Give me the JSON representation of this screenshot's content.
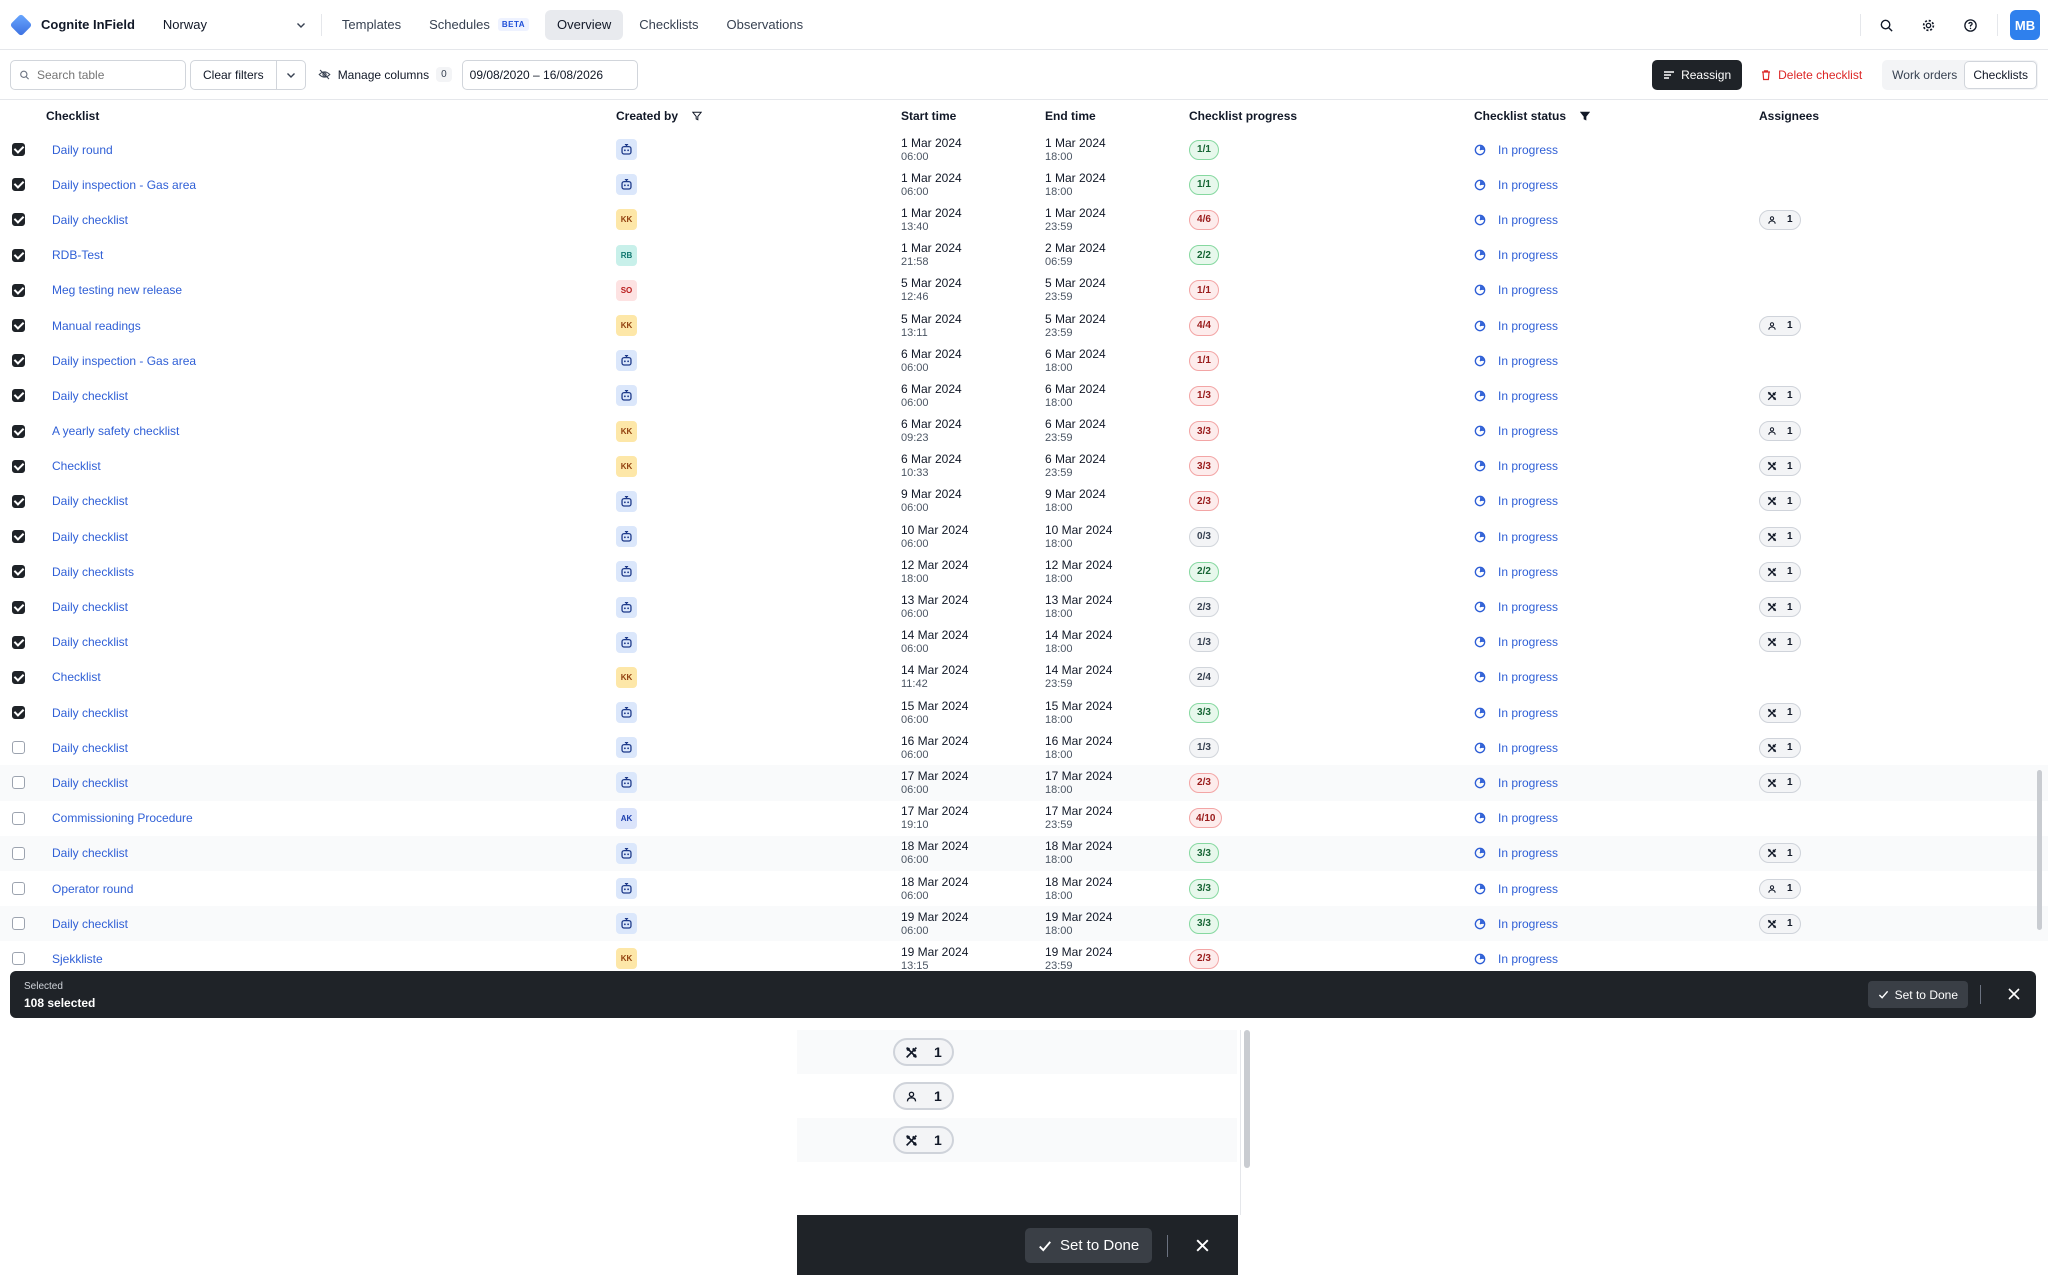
{
  "app": {
    "name": "Cognite InField",
    "site": "Norway",
    "nav_tabs": [
      {
        "label": "Templates",
        "active": false
      },
      {
        "label": "Schedules",
        "badge": "BETA",
        "active": false
      },
      {
        "label": "Overview",
        "active": true
      },
      {
        "label": "Checklists",
        "active": false
      },
      {
        "label": "Observations",
        "active": false
      }
    ],
    "user_initials": "MB",
    "accent_color": "#2f80ed",
    "icons": [
      "search-icon",
      "gear-icon",
      "help-icon"
    ]
  },
  "toolbar": {
    "search_placeholder": "Search table",
    "clear_filters": "Clear filters",
    "manage_columns": "Manage columns",
    "manage_columns_count": "0",
    "date_range": "09/08/2020 – 16/08/2026",
    "reassign": "Reassign",
    "delete_checklist": "Delete checklist",
    "view_toggle": [
      {
        "label": "Work orders",
        "active": false
      },
      {
        "label": "Checklists",
        "active": true
      }
    ]
  },
  "table": {
    "columns": [
      "Checklist",
      "Created by",
      "Start time",
      "End time",
      "Checklist progress",
      "Checklist status",
      "Assignees"
    ],
    "rows": [
      {
        "checked": true,
        "name": "Daily round",
        "creator": "bot",
        "start_date": "1 Mar 2024",
        "start_time": "06:00",
        "end_date": "1 Mar 2024",
        "end_time": "18:00",
        "progress": "1/1",
        "progress_tone": "green",
        "status": "In progress",
        "assignee": null
      },
      {
        "checked": true,
        "name": "Daily inspection - Gas area",
        "creator": "bot",
        "start_date": "1 Mar 2024",
        "start_time": "06:00",
        "end_date": "1 Mar 2024",
        "end_time": "18:00",
        "progress": "1/1",
        "progress_tone": "green",
        "status": "In progress",
        "assignee": null
      },
      {
        "checked": true,
        "name": "Daily checklist",
        "creator": "KK",
        "start_date": "1 Mar 2024",
        "start_time": "13:40",
        "end_date": "1 Mar 2024",
        "end_time": "23:59",
        "progress": "4/6",
        "progress_tone": "red",
        "status": "In progress",
        "assignee": {
          "type": "person",
          "count": "1"
        }
      },
      {
        "checked": true,
        "name": "RDB-Test",
        "creator": "RB",
        "start_date": "1 Mar 2024",
        "start_time": "21:58",
        "end_date": "2 Mar 2024",
        "end_time": "06:59",
        "progress": "2/2",
        "progress_tone": "green",
        "status": "In progress",
        "assignee": null
      },
      {
        "checked": true,
        "name": "Meg testing new release",
        "creator": "SO",
        "start_date": "5 Mar 2024",
        "start_time": "12:46",
        "end_date": "5 Mar 2024",
        "end_time": "23:59",
        "progress": "1/1",
        "progress_tone": "red",
        "status": "In progress",
        "assignee": null
      },
      {
        "checked": true,
        "name": "Manual readings",
        "creator": "KK",
        "start_date": "5 Mar 2024",
        "start_time": "13:11",
        "end_date": "5 Mar 2024",
        "end_time": "23:59",
        "progress": "4/4",
        "progress_tone": "red",
        "status": "In progress",
        "assignee": {
          "type": "person",
          "count": "1"
        }
      },
      {
        "checked": true,
        "name": "Daily inspection - Gas area",
        "creator": "bot",
        "start_date": "6 Mar 2024",
        "start_time": "06:00",
        "end_date": "6 Mar 2024",
        "end_time": "18:00",
        "progress": "1/1",
        "progress_tone": "red",
        "status": "In progress",
        "assignee": null
      },
      {
        "checked": true,
        "name": "Daily checklist",
        "creator": "bot",
        "start_date": "6 Mar 2024",
        "start_time": "06:00",
        "end_date": "6 Mar 2024",
        "end_time": "18:00",
        "progress": "1/3",
        "progress_tone": "red",
        "status": "In progress",
        "assignee": {
          "type": "group",
          "count": "1"
        }
      },
      {
        "checked": true,
        "name": "A yearly safety checklist",
        "creator": "KK",
        "start_date": "6 Mar 2024",
        "start_time": "09:23",
        "end_date": "6 Mar 2024",
        "end_time": "23:59",
        "progress": "3/3",
        "progress_tone": "red",
        "status": "In progress",
        "assignee": {
          "type": "person",
          "count": "1"
        }
      },
      {
        "checked": true,
        "name": "Checklist",
        "creator": "KK",
        "start_date": "6 Mar 2024",
        "start_time": "10:33",
        "end_date": "6 Mar 2024",
        "end_time": "23:59",
        "progress": "3/3",
        "progress_tone": "red",
        "status": "In progress",
        "assignee": {
          "type": "group",
          "count": "1"
        }
      },
      {
        "checked": true,
        "name": "Daily checklist",
        "creator": "bot",
        "start_date": "9 Mar 2024",
        "start_time": "06:00",
        "end_date": "9 Mar 2024",
        "end_time": "18:00",
        "progress": "2/3",
        "progress_tone": "red",
        "status": "In progress",
        "assignee": {
          "type": "group",
          "count": "1"
        }
      },
      {
        "checked": true,
        "name": "Daily checklist",
        "creator": "bot",
        "start_date": "10 Mar 2024",
        "start_time": "06:00",
        "end_date": "10 Mar 2024",
        "end_time": "18:00",
        "progress": "0/3",
        "progress_tone": "grey",
        "status": "In progress",
        "assignee": {
          "type": "group",
          "count": "1"
        }
      },
      {
        "checked": true,
        "name": "Daily checklists",
        "creator": "bot",
        "start_date": "12 Mar 2024",
        "start_time": "18:00",
        "end_date": "12 Mar 2024",
        "end_time": "18:00",
        "progress": "2/2",
        "progress_tone": "green",
        "status": "In progress",
        "assignee": {
          "type": "group",
          "count": "1"
        }
      },
      {
        "checked": true,
        "name": "Daily checklist",
        "creator": "bot",
        "start_date": "13 Mar 2024",
        "start_time": "06:00",
        "end_date": "13 Mar 2024",
        "end_time": "18:00",
        "progress": "2/3",
        "progress_tone": "grey",
        "status": "In progress",
        "assignee": {
          "type": "group",
          "count": "1"
        }
      },
      {
        "checked": true,
        "name": "Daily checklist",
        "creator": "bot",
        "start_date": "14 Mar 2024",
        "start_time": "06:00",
        "end_date": "14 Mar 2024",
        "end_time": "18:00",
        "progress": "1/3",
        "progress_tone": "grey",
        "status": "In progress",
        "assignee": {
          "type": "group",
          "count": "1"
        }
      },
      {
        "checked": true,
        "name": "Checklist",
        "creator": "KK",
        "start_date": "14 Mar 2024",
        "start_time": "11:42",
        "end_date": "14 Mar 2024",
        "end_time": "23:59",
        "progress": "2/4",
        "progress_tone": "grey",
        "status": "In progress",
        "assignee": null
      },
      {
        "checked": true,
        "name": "Daily checklist",
        "creator": "bot",
        "start_date": "15 Mar 2024",
        "start_time": "06:00",
        "end_date": "15 Mar 2024",
        "end_time": "18:00",
        "progress": "3/3",
        "progress_tone": "green",
        "status": "In progress",
        "assignee": {
          "type": "group",
          "count": "1"
        }
      },
      {
        "checked": false,
        "name": "Daily checklist",
        "creator": "bot",
        "start_date": "16 Mar 2024",
        "start_time": "06:00",
        "end_date": "16 Mar 2024",
        "end_time": "18:00",
        "progress": "1/3",
        "progress_tone": "grey",
        "status": "In progress",
        "assignee": {
          "type": "group",
          "count": "1"
        }
      },
      {
        "checked": false,
        "name": "Daily checklist",
        "creator": "bot",
        "start_date": "17 Mar 2024",
        "start_time": "06:00",
        "end_date": "17 Mar 2024",
        "end_time": "18:00",
        "progress": "2/3",
        "progress_tone": "red",
        "status": "In progress",
        "assignee": {
          "type": "group",
          "count": "1"
        }
      },
      {
        "checked": false,
        "name": "Commissioning Procedure",
        "creator": "AK",
        "start_date": "17 Mar 2024",
        "start_time": "19:10",
        "end_date": "17 Mar 2024",
        "end_time": "23:59",
        "progress": "4/10",
        "progress_tone": "red",
        "status": "In progress",
        "assignee": null
      },
      {
        "checked": false,
        "name": "Daily checklist",
        "creator": "bot",
        "start_date": "18 Mar 2024",
        "start_time": "06:00",
        "end_date": "18 Mar 2024",
        "end_time": "18:00",
        "progress": "3/3",
        "progress_tone": "green",
        "status": "In progress",
        "assignee": {
          "type": "group",
          "count": "1"
        }
      },
      {
        "checked": false,
        "name": "Operator round",
        "creator": "bot",
        "start_date": "18 Mar 2024",
        "start_time": "06:00",
        "end_date": "18 Mar 2024",
        "end_time": "18:00",
        "progress": "3/3",
        "progress_tone": "green",
        "status": "In progress",
        "assignee": {
          "type": "person",
          "count": "1"
        }
      },
      {
        "checked": false,
        "name": "Daily checklist",
        "creator": "bot",
        "start_date": "19 Mar 2024",
        "start_time": "06:00",
        "end_date": "19 Mar 2024",
        "end_time": "18:00",
        "progress": "3/3",
        "progress_tone": "green",
        "status": "In progress",
        "assignee": {
          "type": "group",
          "count": "1"
        }
      },
      {
        "checked": false,
        "name": "Sjekkliste",
        "creator": "KK",
        "start_date": "19 Mar 2024",
        "start_time": "13:15",
        "end_date": "19 Mar 2024",
        "end_time": "23:59",
        "progress": "2/3",
        "progress_tone": "red",
        "status": "In progress",
        "assignee": null
      }
    ]
  },
  "selection_bar": {
    "label": "Selected",
    "count": "108 selected",
    "set_to_done": "Set to Done"
  },
  "inset": {
    "chips": [
      {
        "type": "group",
        "count": "1"
      },
      {
        "type": "person",
        "count": "1"
      },
      {
        "type": "group",
        "count": "1"
      }
    ],
    "set_to_done": "Set to Done"
  }
}
